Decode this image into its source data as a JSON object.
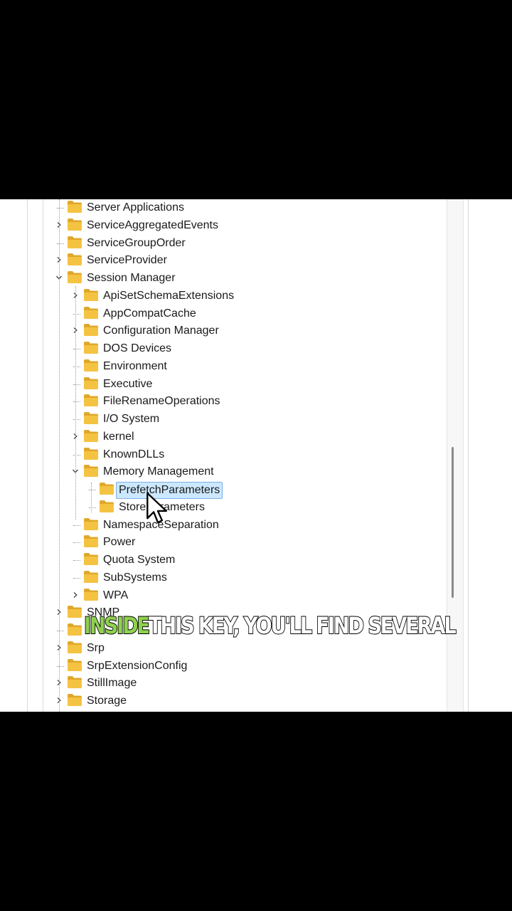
{
  "tree": {
    "items": [
      {
        "label": "Server Applications",
        "level": 0,
        "expander": "none"
      },
      {
        "label": "ServiceAggregatedEvents",
        "level": 0,
        "expander": "collapsed"
      },
      {
        "label": "ServiceGroupOrder",
        "level": 0,
        "expander": "none"
      },
      {
        "label": "ServiceProvider",
        "level": 0,
        "expander": "collapsed"
      },
      {
        "label": "Session Manager",
        "level": 0,
        "expander": "expanded"
      },
      {
        "label": "ApiSetSchemaExtensions",
        "level": 1,
        "expander": "collapsed"
      },
      {
        "label": "AppCompatCache",
        "level": 1,
        "expander": "none"
      },
      {
        "label": "Configuration Manager",
        "level": 1,
        "expander": "collapsed"
      },
      {
        "label": "DOS Devices",
        "level": 1,
        "expander": "none"
      },
      {
        "label": "Environment",
        "level": 1,
        "expander": "none"
      },
      {
        "label": "Executive",
        "level": 1,
        "expander": "none"
      },
      {
        "label": "FileRenameOperations",
        "level": 1,
        "expander": "none"
      },
      {
        "label": "I/O System",
        "level": 1,
        "expander": "none"
      },
      {
        "label": "kernel",
        "level": 1,
        "expander": "collapsed"
      },
      {
        "label": "KnownDLLs",
        "level": 1,
        "expander": "none"
      },
      {
        "label": "Memory Management",
        "level": 1,
        "expander": "expanded"
      },
      {
        "label": "PrefetchParameters",
        "level": 2,
        "expander": "none",
        "selected": true
      },
      {
        "label": "StoreParameters",
        "level": 2,
        "expander": "none"
      },
      {
        "label": "NamespaceSeparation",
        "level": 1,
        "expander": "none"
      },
      {
        "label": "Power",
        "level": 1,
        "expander": "none"
      },
      {
        "label": "Quota System",
        "level": 1,
        "expander": "none"
      },
      {
        "label": "SubSystems",
        "level": 1,
        "expander": "none"
      },
      {
        "label": "WPA",
        "level": 1,
        "expander": "collapsed"
      },
      {
        "label": "SNMP",
        "level": 0,
        "expander": "collapsed"
      },
      {
        "label": "",
        "level": 0,
        "expander": "none"
      },
      {
        "label": "Srp",
        "level": 0,
        "expander": "collapsed"
      },
      {
        "label": "SrpExtensionConfig",
        "level": 0,
        "expander": "none"
      },
      {
        "label": "StillImage",
        "level": 0,
        "expander": "collapsed"
      },
      {
        "label": "Storage",
        "level": 0,
        "expander": "collapsed"
      }
    ]
  },
  "caption": {
    "highlight": "INSIDE",
    "rest": "THIS KEY, YOU'LL FIND SEVERAL"
  },
  "colors": {
    "folder": "#f5c342",
    "folder_dark": "#e0a82a",
    "selection_bg": "#cce8ff",
    "selection_border": "#7ab0e6",
    "caption_highlight": "#8fd14f"
  },
  "icons": {
    "folder": "folder-icon",
    "expander_collapsed": "chevron-right-icon",
    "expander_expanded": "chevron-down-icon",
    "cursor": "mouse-cursor-icon"
  }
}
